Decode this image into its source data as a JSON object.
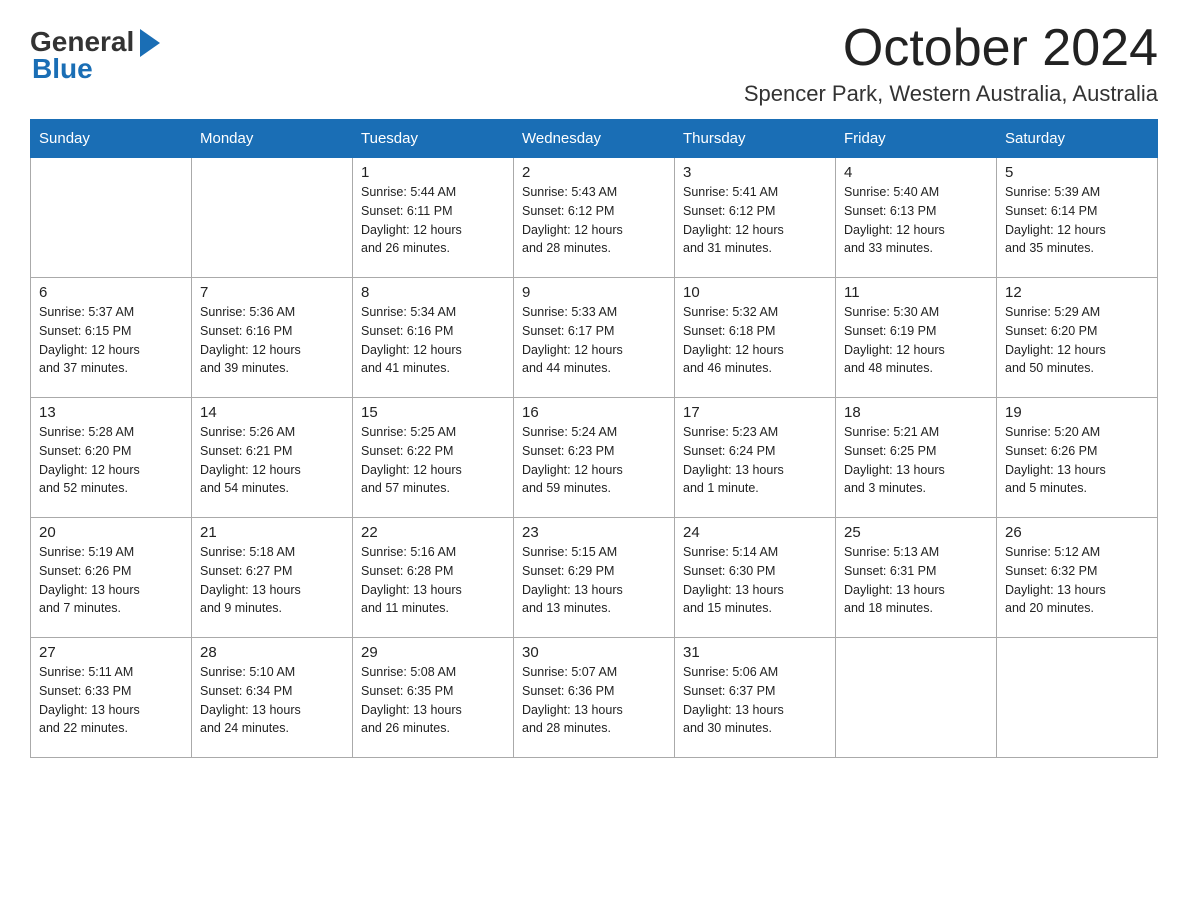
{
  "header": {
    "logo_general": "General",
    "logo_blue": "Blue",
    "month": "October 2024",
    "location": "Spencer Park, Western Australia, Australia"
  },
  "days_of_week": [
    "Sunday",
    "Monday",
    "Tuesday",
    "Wednesday",
    "Thursday",
    "Friday",
    "Saturday"
  ],
  "weeks": [
    [
      {
        "day": "",
        "info": ""
      },
      {
        "day": "",
        "info": ""
      },
      {
        "day": "1",
        "info": "Sunrise: 5:44 AM\nSunset: 6:11 PM\nDaylight: 12 hours\nand 26 minutes."
      },
      {
        "day": "2",
        "info": "Sunrise: 5:43 AM\nSunset: 6:12 PM\nDaylight: 12 hours\nand 28 minutes."
      },
      {
        "day": "3",
        "info": "Sunrise: 5:41 AM\nSunset: 6:12 PM\nDaylight: 12 hours\nand 31 minutes."
      },
      {
        "day": "4",
        "info": "Sunrise: 5:40 AM\nSunset: 6:13 PM\nDaylight: 12 hours\nand 33 minutes."
      },
      {
        "day": "5",
        "info": "Sunrise: 5:39 AM\nSunset: 6:14 PM\nDaylight: 12 hours\nand 35 minutes."
      }
    ],
    [
      {
        "day": "6",
        "info": "Sunrise: 5:37 AM\nSunset: 6:15 PM\nDaylight: 12 hours\nand 37 minutes."
      },
      {
        "day": "7",
        "info": "Sunrise: 5:36 AM\nSunset: 6:16 PM\nDaylight: 12 hours\nand 39 minutes."
      },
      {
        "day": "8",
        "info": "Sunrise: 5:34 AM\nSunset: 6:16 PM\nDaylight: 12 hours\nand 41 minutes."
      },
      {
        "day": "9",
        "info": "Sunrise: 5:33 AM\nSunset: 6:17 PM\nDaylight: 12 hours\nand 44 minutes."
      },
      {
        "day": "10",
        "info": "Sunrise: 5:32 AM\nSunset: 6:18 PM\nDaylight: 12 hours\nand 46 minutes."
      },
      {
        "day": "11",
        "info": "Sunrise: 5:30 AM\nSunset: 6:19 PM\nDaylight: 12 hours\nand 48 minutes."
      },
      {
        "day": "12",
        "info": "Sunrise: 5:29 AM\nSunset: 6:20 PM\nDaylight: 12 hours\nand 50 minutes."
      }
    ],
    [
      {
        "day": "13",
        "info": "Sunrise: 5:28 AM\nSunset: 6:20 PM\nDaylight: 12 hours\nand 52 minutes."
      },
      {
        "day": "14",
        "info": "Sunrise: 5:26 AM\nSunset: 6:21 PM\nDaylight: 12 hours\nand 54 minutes."
      },
      {
        "day": "15",
        "info": "Sunrise: 5:25 AM\nSunset: 6:22 PM\nDaylight: 12 hours\nand 57 minutes."
      },
      {
        "day": "16",
        "info": "Sunrise: 5:24 AM\nSunset: 6:23 PM\nDaylight: 12 hours\nand 59 minutes."
      },
      {
        "day": "17",
        "info": "Sunrise: 5:23 AM\nSunset: 6:24 PM\nDaylight: 13 hours\nand 1 minute."
      },
      {
        "day": "18",
        "info": "Sunrise: 5:21 AM\nSunset: 6:25 PM\nDaylight: 13 hours\nand 3 minutes."
      },
      {
        "day": "19",
        "info": "Sunrise: 5:20 AM\nSunset: 6:26 PM\nDaylight: 13 hours\nand 5 minutes."
      }
    ],
    [
      {
        "day": "20",
        "info": "Sunrise: 5:19 AM\nSunset: 6:26 PM\nDaylight: 13 hours\nand 7 minutes."
      },
      {
        "day": "21",
        "info": "Sunrise: 5:18 AM\nSunset: 6:27 PM\nDaylight: 13 hours\nand 9 minutes."
      },
      {
        "day": "22",
        "info": "Sunrise: 5:16 AM\nSunset: 6:28 PM\nDaylight: 13 hours\nand 11 minutes."
      },
      {
        "day": "23",
        "info": "Sunrise: 5:15 AM\nSunset: 6:29 PM\nDaylight: 13 hours\nand 13 minutes."
      },
      {
        "day": "24",
        "info": "Sunrise: 5:14 AM\nSunset: 6:30 PM\nDaylight: 13 hours\nand 15 minutes."
      },
      {
        "day": "25",
        "info": "Sunrise: 5:13 AM\nSunset: 6:31 PM\nDaylight: 13 hours\nand 18 minutes."
      },
      {
        "day": "26",
        "info": "Sunrise: 5:12 AM\nSunset: 6:32 PM\nDaylight: 13 hours\nand 20 minutes."
      }
    ],
    [
      {
        "day": "27",
        "info": "Sunrise: 5:11 AM\nSunset: 6:33 PM\nDaylight: 13 hours\nand 22 minutes."
      },
      {
        "day": "28",
        "info": "Sunrise: 5:10 AM\nSunset: 6:34 PM\nDaylight: 13 hours\nand 24 minutes."
      },
      {
        "day": "29",
        "info": "Sunrise: 5:08 AM\nSunset: 6:35 PM\nDaylight: 13 hours\nand 26 minutes."
      },
      {
        "day": "30",
        "info": "Sunrise: 5:07 AM\nSunset: 6:36 PM\nDaylight: 13 hours\nand 28 minutes."
      },
      {
        "day": "31",
        "info": "Sunrise: 5:06 AM\nSunset: 6:37 PM\nDaylight: 13 hours\nand 30 minutes."
      },
      {
        "day": "",
        "info": ""
      },
      {
        "day": "",
        "info": ""
      }
    ]
  ]
}
